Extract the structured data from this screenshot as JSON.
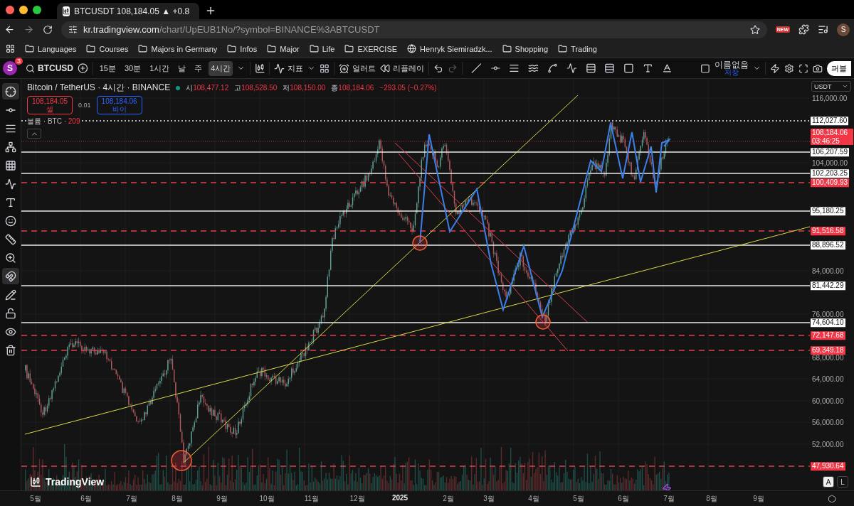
{
  "browser": {
    "tab_title": "BTCUSDT 108,184.05 ▲ +0.8",
    "url_host": "kr.tradingview.com",
    "url_path": "/chart/UpEUB1No/?symbol=BINANCE%3ABTCUSDT",
    "extension_badge": "NEW",
    "profile": "S",
    "bookmarks": [
      {
        "label": "Languages",
        "kind": "folder"
      },
      {
        "label": "Courses",
        "kind": "folder"
      },
      {
        "label": "Majors in Germany",
        "kind": "folder"
      },
      {
        "label": "Infos",
        "kind": "folder"
      },
      {
        "label": "Major",
        "kind": "folder"
      },
      {
        "label": "Life",
        "kind": "folder"
      },
      {
        "label": "EXERCISE",
        "kind": "folder"
      },
      {
        "label": "Henryk Siemiradzk...",
        "kind": "site"
      },
      {
        "label": "Shopping",
        "kind": "folder"
      },
      {
        "label": "Trading",
        "kind": "folder"
      }
    ]
  },
  "toolbar": {
    "avatar": "S",
    "notifications": "3",
    "symbol": "BTCUSD",
    "intervals": [
      {
        "label": "15분",
        "selected": false
      },
      {
        "label": "30분",
        "selected": false
      },
      {
        "label": "1시간",
        "selected": false
      },
      {
        "label": "날",
        "selected": false
      },
      {
        "label": "주",
        "selected": false
      },
      {
        "label": "4시간",
        "selected": true
      }
    ],
    "indicators": "지표",
    "alert": "얼러트",
    "replay": "리플레이",
    "layout_name": "이름없음",
    "layout_status": "저장",
    "publish": "퍼블"
  },
  "left_tools": [
    {
      "active": true
    },
    {
      "active": false
    },
    {
      "active": false
    },
    {
      "active": false
    },
    {
      "active": false
    },
    {
      "active": false
    },
    {
      "active": false
    },
    {
      "active": false
    },
    {
      "active": false
    },
    {
      "active": false
    },
    {
      "active": true
    },
    {
      "active": false
    },
    {
      "active": false
    },
    {
      "active": false
    },
    {
      "active": false
    }
  ],
  "legend": {
    "title": "Bitcoin / TetherUS · 4시간 · BINANCE",
    "market_open": true,
    "ohlc": [
      {
        "label": "시",
        "value": "108,477.12"
      },
      {
        "label": "고",
        "value": "108,528.50"
      },
      {
        "label": "저",
        "value": "108,150.00"
      },
      {
        "label": "종",
        "value": "108,184.06"
      }
    ],
    "change": "−293.05 (−0.27%)",
    "sell": {
      "price": "108,184.05",
      "label": "셀"
    },
    "spread": "0.01",
    "buy": {
      "price": "108,184.06",
      "label": "바이"
    },
    "volume_label": "볼륨 · BTC ·",
    "volume_value": "209"
  },
  "price_axis": {
    "currency": "USDT",
    "ticks": [
      "116,000.00",
      "104,000.00",
      "84,000.00",
      "76,000.00",
      "68,000.00",
      "64,000.00",
      "60,000.00",
      "56,000.00",
      "52,000.00"
    ],
    "last_price": "108,184.06",
    "countdown": "03:46:25",
    "levels": [
      {
        "price": "112,027.60",
        "kind": "dotted"
      },
      {
        "price": "106,207.59",
        "kind": "solid"
      },
      {
        "price": "102,203.25",
        "kind": "solid"
      },
      {
        "price": "100,409.93",
        "kind": "dashed"
      },
      {
        "price": "95,180.25",
        "kind": "solid"
      },
      {
        "price": "91,516.58",
        "kind": "dashed"
      },
      {
        "price": "88,896.52",
        "kind": "solid"
      },
      {
        "price": "81,442.29",
        "kind": "solid"
      },
      {
        "price": "74,604.10",
        "kind": "solid"
      },
      {
        "price": "72,147.68",
        "kind": "dashed"
      },
      {
        "price": "69,349.18",
        "kind": "dashed"
      },
      {
        "price": "47,930.64",
        "kind": "dashed"
      }
    ]
  },
  "time_axis": [
    {
      "text": "5월",
      "bold": false
    },
    {
      "text": "6월",
      "bold": false
    },
    {
      "text": "7월",
      "bold": false
    },
    {
      "text": "8월",
      "bold": false
    },
    {
      "text": "9월",
      "bold": false
    },
    {
      "text": "10월",
      "bold": false
    },
    {
      "text": "11월",
      "bold": false
    },
    {
      "text": "12월",
      "bold": false
    },
    {
      "text": "2025",
      "bold": true
    },
    {
      "text": "2월",
      "bold": false
    },
    {
      "text": "3월",
      "bold": false
    },
    {
      "text": "4월",
      "bold": false
    },
    {
      "text": "5월",
      "bold": false
    },
    {
      "text": "6월",
      "bold": false
    },
    {
      "text": "7월",
      "bold": false
    },
    {
      "text": "8월",
      "bold": false
    },
    {
      "text": "9월",
      "bold": false
    }
  ],
  "scale_buttons": [
    {
      "label": "A",
      "selected": true
    },
    {
      "label": "L",
      "selected": false
    }
  ],
  "logo": "TradingView"
}
